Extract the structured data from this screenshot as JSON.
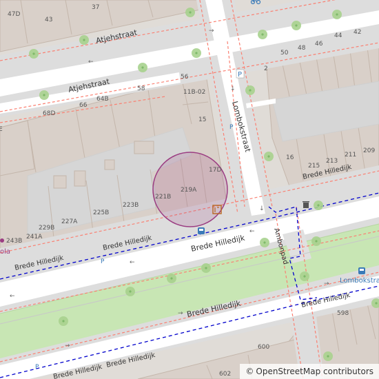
{
  "streets": {
    "atjehstraat_a": "Atjehstraat",
    "atjehstraat_b": "Atjehstraat",
    "lombokstraat": "Lombokstraat",
    "hilledijk_1": "Brede Hilledijk",
    "hilledijk_2": "Brede Hilledijk",
    "hilledijk_3": "Brede Hilledijk",
    "hilledijk_4": "Brede Hilledijk",
    "hilledijk_5": "Brede Hilledijk",
    "hilledijk_6": "Brede Hilledijk",
    "hilledijk_7": "Brede Hilledijk",
    "hilledijk_8": "Brede Hilledijk",
    "ambonpad": "Ambonpad"
  },
  "house_numbers": {
    "n47d": "47D",
    "n43": "43",
    "n37": "37",
    "n68d": "68D",
    "n66": "66",
    "n64b": "64B",
    "n58": "58",
    "n56": "56",
    "n11b02": "11B-02",
    "n15": "15",
    "n17d": "17D",
    "n219a": "219A",
    "n221b": "221B",
    "n223b": "223B",
    "n225b": "225B",
    "n227a": "227A",
    "n229b": "229B",
    "n241a": "241A",
    "n243b": "243B",
    "n50": "50",
    "n48": "48",
    "n46": "46",
    "n44": "44",
    "n42": "42",
    "n2": "2",
    "n16": "16",
    "n215": "215",
    "n213": "213",
    "n211": "211",
    "n209": "209",
    "n598": "598",
    "n600": "600",
    "n602": "602"
  },
  "pois": {
    "bus_stop_name": "Lombokstraat",
    "bus_stop_icon": "bus-stop-icon",
    "parking_label": "P",
    "cut_label_left": "ola",
    "cut_letter_e": "E"
  },
  "icons": {
    "bicycle": "bicycle-icon",
    "waste_basket": "waste-basket-icon",
    "bus": "bus-icon",
    "mailbox": "mailbox-icon"
  },
  "highlight": {
    "shape": "circle",
    "color": "#9b3d82"
  },
  "colors": {
    "background": "#e0dcd7",
    "building": "#d9d0c9",
    "road": "#ffffff",
    "sidewalk": "#dddddd",
    "green_strip": "#c8e6b4",
    "bus_route": "#0000cc",
    "footway": "#fa8072",
    "tram_track": "#999999"
  },
  "attribution": {
    "symbol": "©",
    "text": "OpenStreetMap contributors"
  }
}
